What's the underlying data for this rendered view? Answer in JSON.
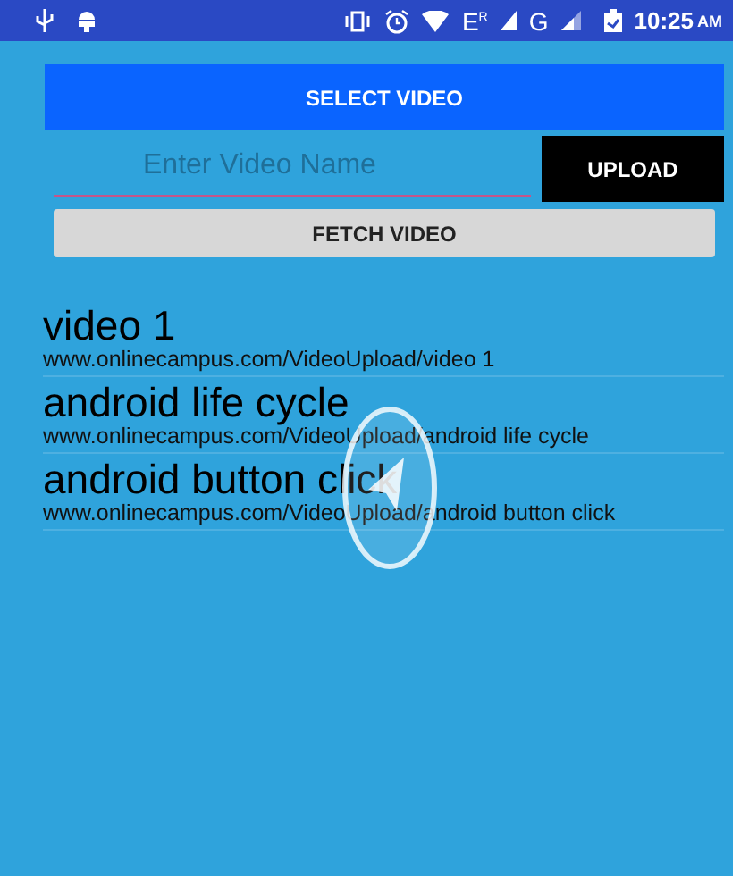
{
  "status_bar": {
    "network_1": "E$^{R}$",
    "network_2": "G",
    "time": "10:25",
    "meridiem": "AM"
  },
  "select_button": "SELECT VIDEO",
  "name_field": {
    "placeholder": "Enter Video Name"
  },
  "upload_button": "UPLOAD",
  "fetch_button": "FETCH VIDEO",
  "videos": [
    {
      "title": "video 1",
      "url": "www.onlinecampus.com/VideoUpload/video 1"
    },
    {
      "title": "android life cycle",
      "url": "www.onlinecampus.com/VideoUpload/android life cycle"
    },
    {
      "title": "android button click",
      "url": "www.onlinecampus.com/VideoUpload/android button click"
    }
  ]
}
